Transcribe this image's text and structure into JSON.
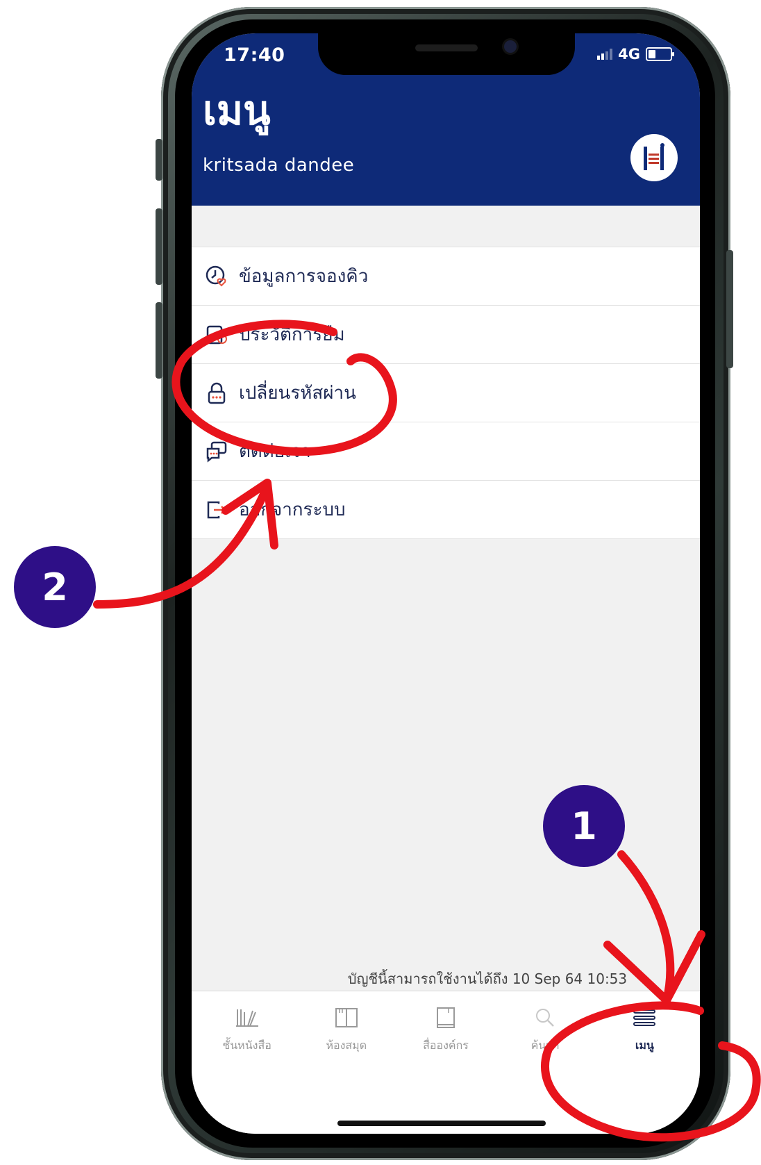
{
  "status_bar": {
    "time": "17:40",
    "network": "4G"
  },
  "header": {
    "title": "เมนู",
    "user_name": "kritsada dandee"
  },
  "menu_items": [
    {
      "label": "ข้อมูลการจองคิว",
      "icon": "clock-heart-icon"
    },
    {
      "label": "ประวัติการยืม",
      "icon": "history-icon"
    },
    {
      "label": "เปลี่ยนรหัสผ่าน",
      "icon": "lock-icon"
    },
    {
      "label": "ติดต่อเรา",
      "icon": "chat-icon"
    },
    {
      "label": "ออกจากระบบ",
      "icon": "logout-icon"
    }
  ],
  "account_notice": "บัญชีนี้สามารถใช้งานได้ถึง 10 Sep 64 10:53",
  "tabs": [
    {
      "label": "ชั้นหนังสือ",
      "icon": "bookshelf-icon"
    },
    {
      "label": "ห้องสมุด",
      "icon": "library-icon"
    },
    {
      "label": "สื่อองค์กร",
      "icon": "media-icon"
    },
    {
      "label": "ค้นหา",
      "icon": "search-icon"
    },
    {
      "label": "เมนู",
      "icon": "hamburger-icon",
      "active": true
    }
  ],
  "annotations": {
    "step1": "1",
    "step2": "2"
  },
  "colors": {
    "header_bg": "#0e2a78",
    "annotation_red": "#e8141c",
    "badge_bg": "#2e0f87"
  }
}
